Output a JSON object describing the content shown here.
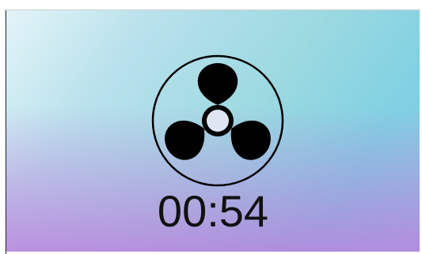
{
  "timer": {
    "value": "00:54"
  },
  "icons": {
    "fan": "fan-icon"
  },
  "colors": {
    "icon_color": "#000000",
    "text_color": "#111111",
    "gradient_top": "#e3f4f8",
    "gradient_right": "#7fd0e2",
    "gradient_bottom": "#be78dc"
  }
}
